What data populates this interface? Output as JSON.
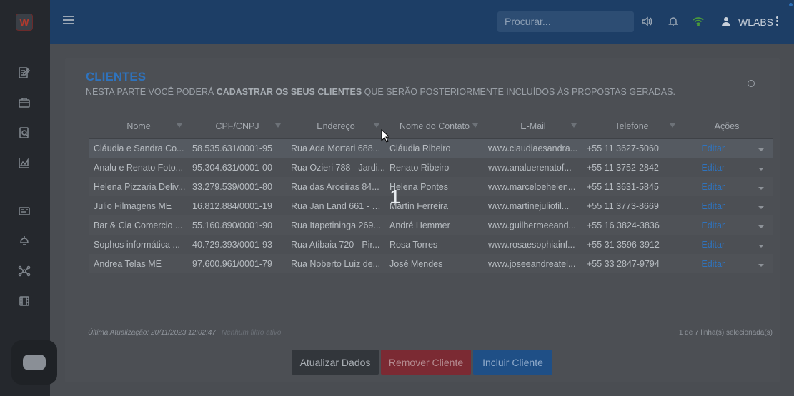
{
  "topbar": {
    "search_placeholder": "Procurar...",
    "user_name": "WLABS"
  },
  "logo": {
    "letter": "W"
  },
  "sidebar": {
    "items": [
      {
        "icon": "edit-document-icon"
      },
      {
        "icon": "briefcase-icon"
      },
      {
        "icon": "document-search-icon"
      },
      {
        "icon": "area-chart-icon"
      },
      {
        "icon": "id-card-icon"
      },
      {
        "icon": "ceiling-lamp-icon"
      },
      {
        "icon": "network-icon"
      },
      {
        "icon": "film-icon"
      }
    ]
  },
  "card": {
    "title": "CLIENTES",
    "desc_prefix": "NESTA PARTE VOCÊ PODERÁ ",
    "desc_bold": "CADASTRAR OS SEUS CLIENTES",
    "desc_suffix": " QUE SERÃO POSTERIORMENTE INCLUÍDOS ÀS PROPOSTAS GERADAS."
  },
  "table": {
    "headers": [
      "Nome",
      "CPF/CNPJ",
      "Endereço",
      "Nome do Contato",
      "E-Mail",
      "Telefone",
      "Ações"
    ],
    "rows": [
      [
        "Cláudia e Sandra Co...",
        "58.535.631/0001-95",
        "Rua Ada Mortari 688...",
        "Cláudia Ribeiro",
        "www.claudiaesandra...",
        "+55 11 3627-5060",
        "Editar"
      ],
      [
        "Analu e Renato Foto...",
        "95.304.631/0001-00",
        "Rua Ozieri 788 - Jardi...",
        "Renato Ribeiro",
        "www.analuerenatof...",
        "+55 11 3752-2842",
        "Editar"
      ],
      [
        "Helena Pizzaria Deliv...",
        "33.279.539/0001-80",
        "Rua das Aroeiras 84...",
        "Helena Pontes",
        "www.marceloehelen...",
        "+55 11 3631-5845",
        "Editar"
      ],
      [
        "Julio Filmagens ME",
        "16.812.884/0001-19",
        "Rua Jan Land 661 - Vi...",
        "Martin Ferreira",
        "www.martinejuliofil...",
        "+55 11 3773-8669",
        "Editar"
      ],
      [
        "Bar & Cia Comercio ...",
        "55.160.890/0001-90",
        "Rua Itapetininga 269...",
        "André Hemmer",
        "www.guilhermeeand...",
        "+55 16 3824-3836",
        "Editar"
      ],
      [
        "Sophos informática ...",
        "40.729.393/0001-93",
        "Rua Atibaia 720 - Pir...",
        "Rosa Torres",
        "www.rosaesophiainf...",
        "+55 31 3596-3912",
        "Editar"
      ],
      [
        "Andrea Telas ME",
        "97.600.961/0001-79",
        "Rua Noberto Luiz de...",
        "José Mendes",
        "www.joseeandreatel...",
        "+55 33 2847-9794",
        "Editar"
      ]
    ]
  },
  "footer": {
    "last_update": "Última Atualização: 20/11/2023 12:02:47",
    "no_filter": "Nenhum filtro ativo",
    "selected_count": "1 de 7 linha(s) selecionada(s)"
  },
  "buttons": {
    "update": "Atualizar Dados",
    "remove": "Remover Cliente",
    "add": "Incluir Cliente"
  },
  "overlay_number": "1",
  "colors": {
    "accent": "#2f73bd",
    "topbar": "#1d3e66",
    "sidebar": "#25282d",
    "danger": "#7b2a33"
  }
}
